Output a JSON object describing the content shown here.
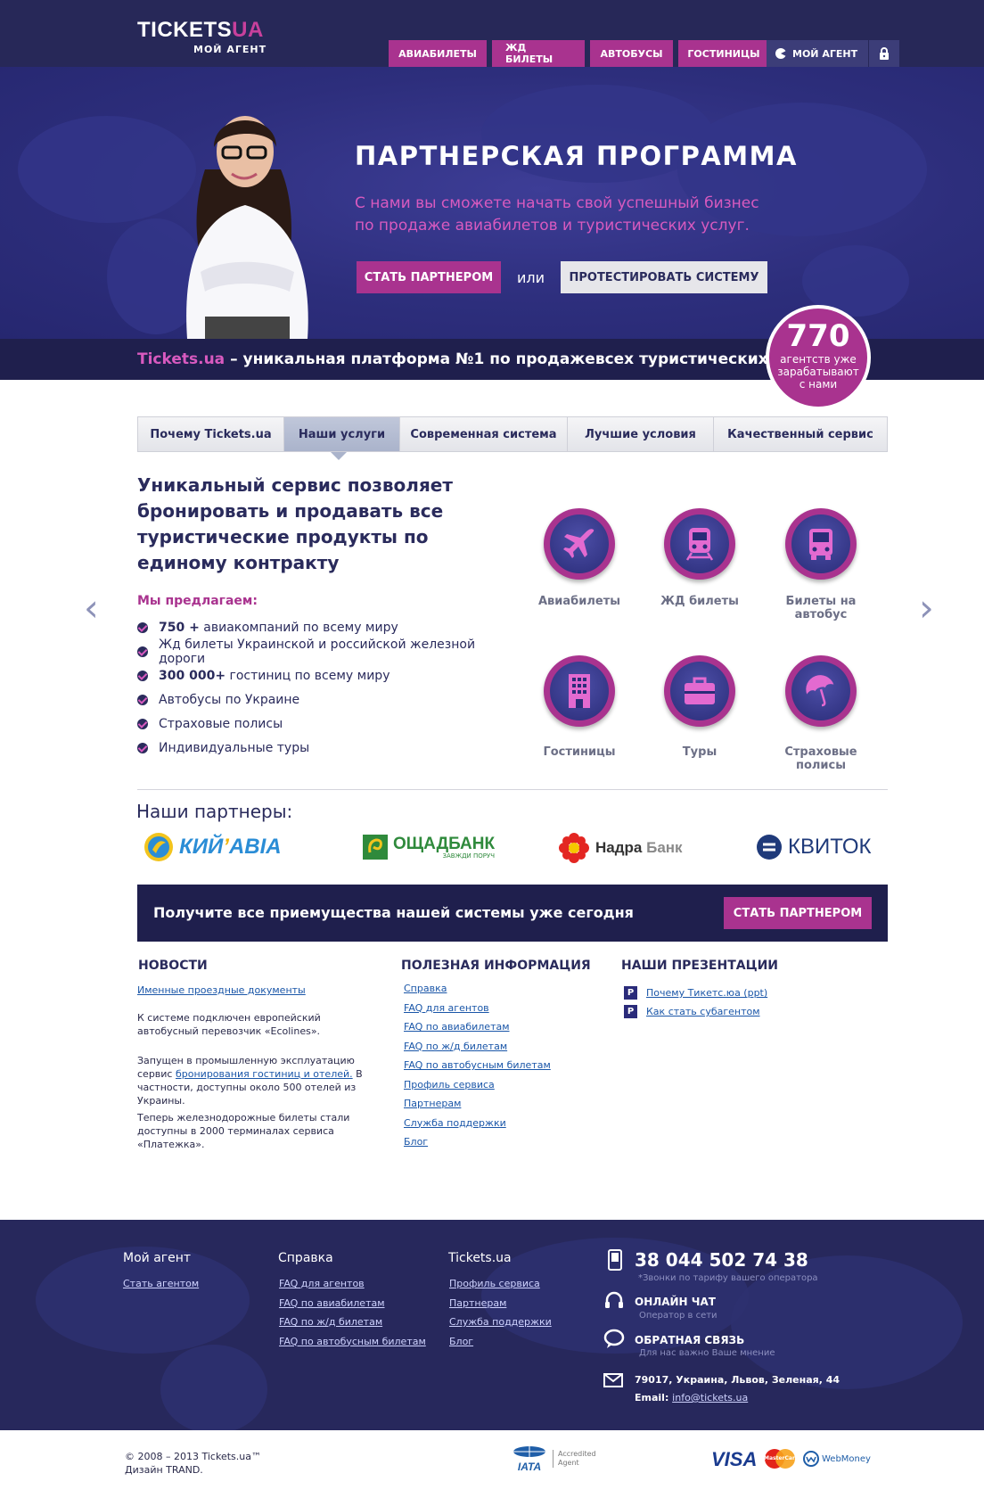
{
  "brand": {
    "logo_main": "TICKETS",
    "logo_ua": "UA",
    "logo_sub": "МОЙ АГЕНТ"
  },
  "nav": {
    "items": [
      "АВИАБИЛЕТЫ",
      "ЖД БИЛЕТЫ",
      "АВТОБУСЫ",
      "ГОСТИНИЦЫ"
    ],
    "agent_label": "МОЙ АГЕНТ"
  },
  "hero": {
    "title": "ПАРТНЕРСКАЯ ПРОГРАММА",
    "subtitle_line1": "С нами вы сможете начать свой успешный бизнес",
    "subtitle_line2": "по продаже авиабилетов и туристических услуг.",
    "btn_partner": "СТАТЬ ПАРТНЕРОМ",
    "or": "или",
    "btn_test": "ПРОТЕСТИРОВАТЬ СИСТЕМУ"
  },
  "strip": {
    "brand": "Tickets.ua",
    "text": " – уникальная платформа №1 по продажевсех туристических услуг."
  },
  "badge": {
    "number": "770",
    "text_line1": "агентств уже",
    "text_line2": "зарабатывают",
    "text_line3": "с нами"
  },
  "tabs": [
    "Почему Tickets.ua",
    "Наши услуги",
    "Современная система",
    "Лучшие условия",
    "Качественный сервис"
  ],
  "services": {
    "title": "Уникальный сервис позволяет бронировать и продавать все туристические продукты по единому контракту",
    "offer_label": "Мы предлагаем:",
    "list": [
      {
        "bold": "750 +",
        "text": " авиакомпаний по всему миру"
      },
      {
        "bold": "",
        "text": "Жд билеты Украинской и российской железной дороги"
      },
      {
        "bold": "300 000+",
        "text": " гостиниц по всему миру"
      },
      {
        "bold": "",
        "text": "Автобусы по Украине"
      },
      {
        "bold": "",
        "text": "Страховые полисы"
      },
      {
        "bold": "",
        "text": "Индивидуальные туры"
      }
    ],
    "icons": [
      {
        "label": "Авиабилеты",
        "icon": "plane-icon"
      },
      {
        "label": "ЖД билеты",
        "icon": "train-icon"
      },
      {
        "label": "Билеты на автобус",
        "icon": "bus-icon"
      },
      {
        "label": "Гостиницы",
        "icon": "hotel-icon"
      },
      {
        "label": "Туры",
        "icon": "suitcase-icon"
      },
      {
        "label": "Страховые полисы",
        "icon": "umbrella-icon"
      }
    ],
    "arrow_left": "‹",
    "arrow_right": "›"
  },
  "partners": {
    "title": "Наши партнеры:",
    "kiy_a": "КИЙ",
    "kiy_b": "АВІА",
    "osh_main": "ОЩАДБАНК",
    "osh_sub": "ЗАВЖДИ ПОРУЧ",
    "nadra_a": "Надра",
    "nadra_b": " Банк",
    "kvitok": "КВИТОК"
  },
  "cta": {
    "text": "Получите все приемущества нашей системы уже сегодня",
    "button": "СТАТЬ ПАРТНЕРОМ"
  },
  "news": {
    "title": "НОВОСТИ",
    "link1": "Именные проездные документы",
    "p1": "К системе подключен европейский автобусный перевозчик «Ecolines».",
    "p2_a": "Запущен в промышленную эксплуатацию сервис ",
    "p2_link": "бронирования гостиниц и отелей.",
    "p2_b": " В частности, доступны около 500 отелей из Украины.",
    "p3": "Теперь железнодорожные билеты стали доступны в 2000 терминалах сервиса «Платежка»."
  },
  "useful": {
    "title": "ПОЛЕЗНАЯ ИНФОРМАЦИЯ",
    "links": [
      "Справка",
      "FAQ для агентов",
      "FAQ по авиабилетам",
      "FAQ по ж/д билетам",
      "FAQ по автобусным билетам",
      "Профиль сервиса",
      "Партнерам",
      "Служба поддержки",
      "Блог"
    ]
  },
  "presentations": {
    "title": "НАШИ ПРЕЗЕНТАЦИИ",
    "p": "P",
    "links": [
      "Почему Тикетс.юа (ppt)",
      "Как стать субагентом"
    ]
  },
  "footer": {
    "col1": {
      "title": "Мой агент",
      "links": [
        "Стать агентом"
      ]
    },
    "col2": {
      "title": "Справка",
      "links": [
        "FAQ для агентов",
        "FAQ по авиабилетам",
        "FAQ по ж/д билетам",
        "FAQ по автобусным билетам"
      ]
    },
    "col3": {
      "title": "Tickets.ua",
      "links": [
        "Профиль сервиса",
        "Партнерам",
        "Служба поддержки",
        "Блог"
      ]
    },
    "phone": "38 044 502 74 38",
    "phone_note": "*Звонки по тарифу вашего оператора",
    "chat_title": "ОНЛАЙН ЧАТ",
    "chat_note": "Оператор в сети",
    "feedback_title": "ОБРАТНАЯ СВЯЗЬ",
    "feedback_note": "Для нас важно Ваше мнение",
    "address": "79017, Украина, Львов, Зеленая, 44",
    "email_label": "Email: ",
    "email": "info@tickets.ua"
  },
  "bottom": {
    "copy1": "© 2008 – 2013 Tickets.ua™",
    "copy2": "Дизайн TRAND.",
    "iata": "IATA",
    "accredited1": "Accredited",
    "accredited2": "Agent",
    "visa": "VISA",
    "mastercard": "MasterCard",
    "webmoney": "WebMoney"
  },
  "colors": {
    "navy": "#272858",
    "pink": "#a9338f",
    "hero_blue": "#2d2e7c"
  }
}
